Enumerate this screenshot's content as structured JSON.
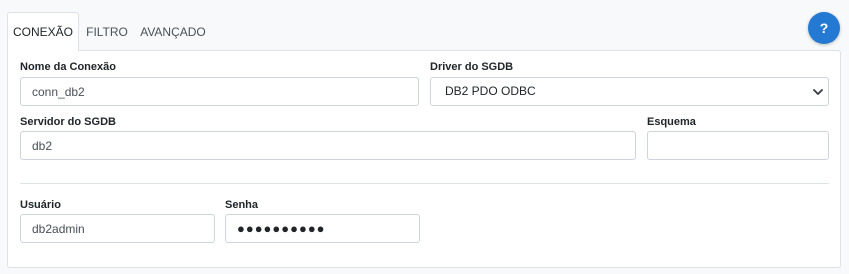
{
  "tabs": [
    {
      "label": "CONEXÃO",
      "active": true
    },
    {
      "label": "FILTRO",
      "active": false
    },
    {
      "label": "AVANÇADO",
      "active": false
    }
  ],
  "help": {
    "label": "?",
    "color": "#2479d2"
  },
  "form": {
    "connection_name": {
      "label": "Nome da Conexão",
      "value": "conn_db2"
    },
    "driver": {
      "label": "Driver do SGDB",
      "value": "DB2 PDO ODBC",
      "icon": "chevron-down-icon"
    },
    "server": {
      "label": "Servidor do SGDB",
      "value": "db2"
    },
    "schema": {
      "label": "Esquema",
      "value": ""
    },
    "user": {
      "label": "Usuário",
      "value": "db2admin"
    },
    "password": {
      "label": "Senha",
      "value": "●●●●●●●●●●"
    }
  }
}
